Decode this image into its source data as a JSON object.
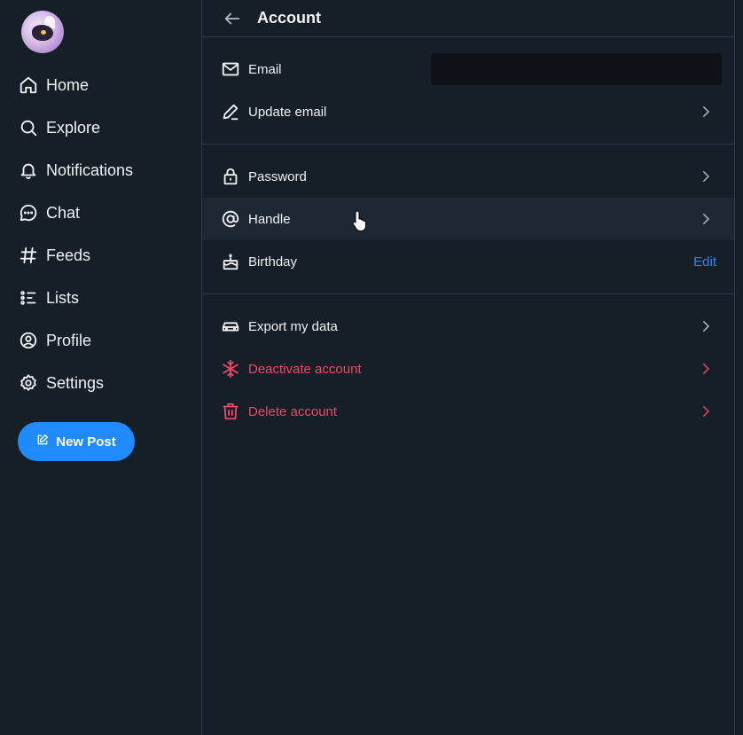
{
  "sidebar": {
    "nav": [
      {
        "label": "Home",
        "icon": "home-icon"
      },
      {
        "label": "Explore",
        "icon": "search-icon"
      },
      {
        "label": "Notifications",
        "icon": "bell-icon"
      },
      {
        "label": "Chat",
        "icon": "chat-icon"
      },
      {
        "label": "Feeds",
        "icon": "hash-icon"
      },
      {
        "label": "Lists",
        "icon": "list-icon"
      },
      {
        "label": "Profile",
        "icon": "profile-icon"
      },
      {
        "label": "Settings",
        "icon": "gear-icon"
      }
    ],
    "new_post_label": "New Post"
  },
  "header": {
    "title": "Account"
  },
  "sections": {
    "email": {
      "email_label": "Email",
      "update_email_label": "Update email"
    },
    "security": {
      "password_label": "Password",
      "handle_label": "Handle",
      "birthday_label": "Birthday",
      "birthday_action": "Edit"
    },
    "data": {
      "export_label": "Export my data",
      "deactivate_label": "Deactivate account",
      "delete_label": "Delete account"
    }
  },
  "colors": {
    "background": "#161e27",
    "accent": "#208bfe",
    "danger": "#ec4868",
    "divider": "#2e3a48"
  }
}
